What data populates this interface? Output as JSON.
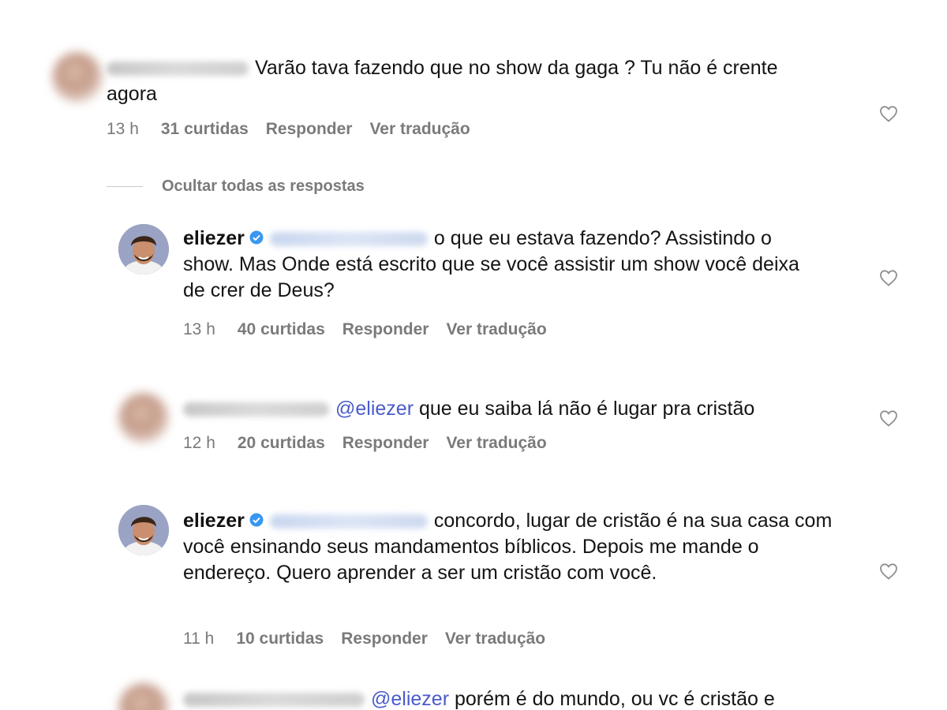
{
  "comments": [
    {
      "text": "Varão tava fazendo que no show da gaga ? Tu não é crente agora",
      "time": "13 h",
      "likes": "31 curtidas",
      "reply": "Responder",
      "translate": "Ver tradução"
    },
    {
      "username": "eliezer",
      "text": "o que eu estava fazendo? Assistindo o show. Mas Onde está escrito que se você assistir um show você deixa de crer de Deus?",
      "time": "13 h",
      "likes": "40 curtidas",
      "reply": "Responder",
      "translate": "Ver tradução"
    },
    {
      "mention": "@eliezer",
      "text": "que eu saiba lá não é lugar pra cristão",
      "time": "12 h",
      "likes": "20 curtidas",
      "reply": "Responder",
      "translate": "Ver tradução"
    },
    {
      "username": "eliezer",
      "text": "concordo, lugar de cristão é na sua casa com você ensinando seus mandamentos bíblicos. Depois me mande o endereço. Quero aprender a ser um cristão com você.",
      "time": "11 h",
      "likes": "10 curtidas",
      "reply": "Responder",
      "translate": "Ver tradução"
    },
    {
      "mention": "@eliezer",
      "text": "porém é do mundo, ou vc é cristão e"
    }
  ],
  "hide_replies_label": "Ocultar todas as respostas",
  "colors": {
    "mention": "#4a5bcb",
    "meta": "#7a7a7a",
    "verified": "#3897f0"
  },
  "icons": {
    "like": "heart-outline-icon",
    "verified": "verified-badge-icon"
  }
}
